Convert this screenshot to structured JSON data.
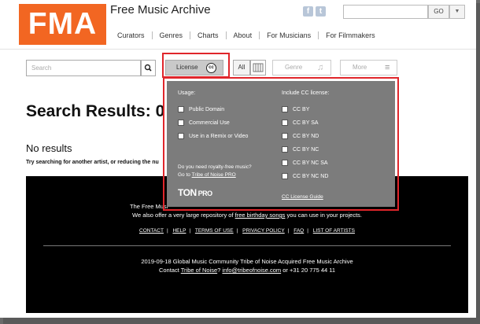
{
  "header": {
    "logo_text": "FMA",
    "site_title": "Free Music Archive",
    "nav": [
      "Curators",
      "Genres",
      "Charts",
      "About",
      "For Musicians",
      "For Filmmakers"
    ],
    "social_icons": [
      "facebook-icon",
      "twitter-icon"
    ],
    "search_value": "",
    "go_label": "GO"
  },
  "filters": {
    "search_placeholder": "Search",
    "license_label": "License",
    "cc_badge": "cc",
    "all_label": "All",
    "genre_label": "Genre",
    "more_label": "More"
  },
  "results": {
    "title": "Search Results: 0",
    "no_results": "No results",
    "hint": "Try searching for another artist, or reducing the nu"
  },
  "license_dropdown": {
    "usage_heading": "Usage:",
    "usage_options": [
      "Public Domain",
      "Commercial Use",
      "Use in a Remix or Video"
    ],
    "cc_heading": "Include CC license:",
    "cc_options": [
      "CC BY",
      "CC BY SA",
      "CC BY ND",
      "CC BY NC",
      "CC BY NC SA",
      "CC BY NC ND"
    ],
    "royalty_question": "Do you need royalty-free music?",
    "go_to": "Go to",
    "tribe_link": "Tribe of Noise PRO",
    "ton_logo": "TON",
    "ton_pro": "PRO",
    "cc_guide": "CC License Guide"
  },
  "footer": {
    "line1_start": "The Free Musi",
    "line2_pre": "We also offer a very large repository of",
    "line2_link": "free birthday songs",
    "line2_post": "you can use in your projects.",
    "links": [
      "CONTACT",
      "HELP",
      "TERMS OF USE",
      "PRIVACY POLICY",
      "FAQ",
      "LIST OF ARTISTS"
    ],
    "news": "2019-09-18 Global Music Community Tribe of Noise Acquired Free Music Archive",
    "contact_pre": "Contact",
    "contact_link": "Tribe of Noise",
    "contact_mid": "?",
    "email": "info@tribeofnoise.com",
    "phone": "or +31 20 775 44 11"
  },
  "colors": {
    "brand_orange": "#f26622",
    "highlight_red": "#e0262b",
    "dropdown_gray": "#7c7c7c"
  }
}
